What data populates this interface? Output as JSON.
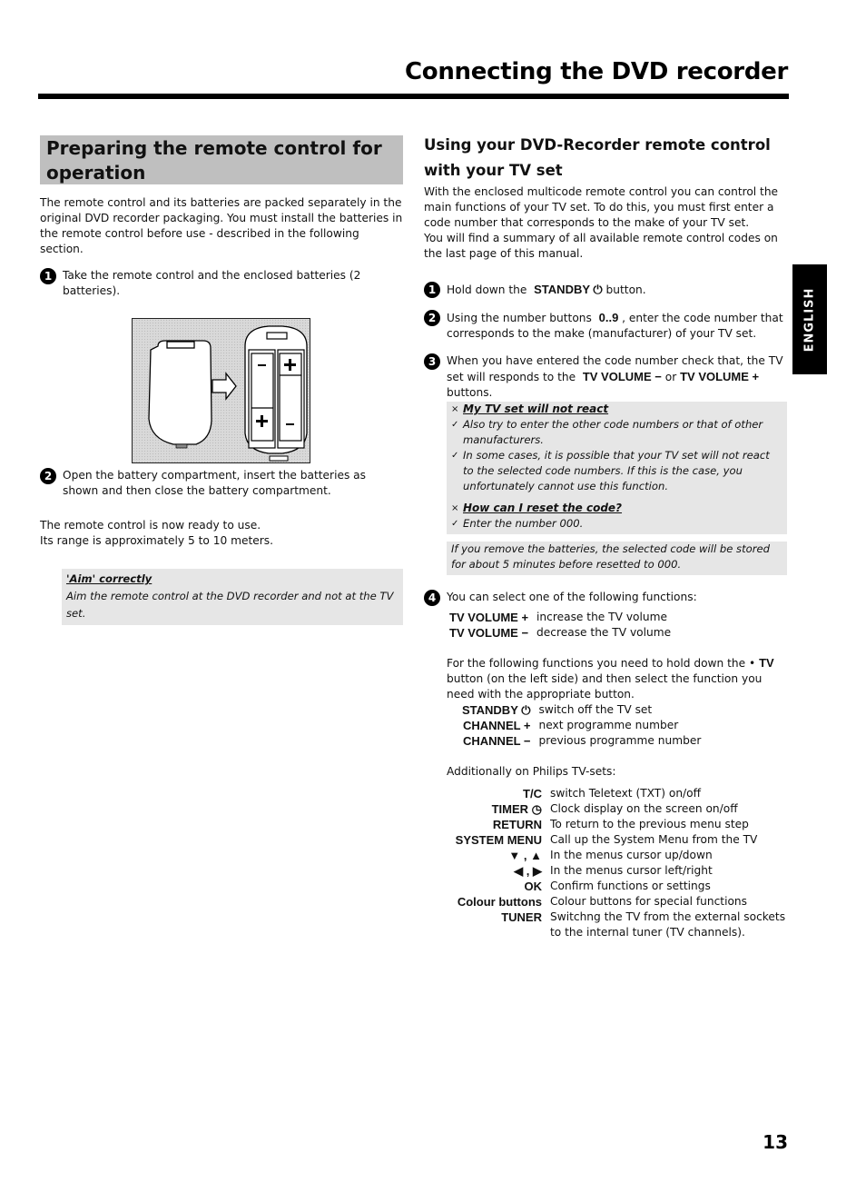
{
  "header": {
    "title": "Connecting the DVD recorder"
  },
  "left": {
    "heading": "Preparing the remote control for operation",
    "intro": "The remote control and its batteries are packed separately in the original DVD recorder packaging. You must install the batteries in the remote control before use - described in the following section.",
    "steps": [
      {
        "num": "1",
        "text": "Take the remote control and the enclosed batteries (2 batteries)."
      },
      {
        "num": "2",
        "text": "Open the battery compartment, insert the batteries as shown and then close the battery compartment."
      }
    ],
    "figure_alt": "Battery cover removed, arrow pointing to open battery compartment with two batteries",
    "ready_line1": "The remote control is now ready to use.",
    "ready_line2": "Its range is approximately 5 to 10 meters.",
    "note": {
      "title": "'Aim' correctly",
      "text": "Aim the remote control at the DVD recorder and not at the TV set."
    }
  },
  "right": {
    "heading_line1": "Using your DVD-Recorder remote control",
    "heading_line2": "with your TV set",
    "intro1": "With the enclosed multicode remote control you can control the main functions of your TV set. To do this, you must first enter a code number that corresponds to the make of your TV set.",
    "intro2": "You will find a summary of all available remote control codes on the last page of this manual.",
    "step1": {
      "num": "1",
      "pre": "Hold down the",
      "button": "STANDBY ⏻",
      "post": "button."
    },
    "step2": {
      "num": "2",
      "pre": "Using the number buttons",
      "button": "0..9",
      "post": ", enter the code number that corresponds to the make (manufacturer) of your TV set."
    },
    "step3": {
      "num": "3",
      "pre": "When you have entered the code number check that, the TV set will responds to the",
      "button1": "TV VOLUME −",
      "mid": "or",
      "button2": "TV VOLUME +",
      "post": "buttons."
    },
    "tips": {
      "q1": "My TV set will not react",
      "a1": "Also try to enter the other code numbers or that of other manufacturers.",
      "a2": "In some cases, it is possible that your TV set will not react to the selected code numbers. If this is the case, you unfortunately cannot use this function.",
      "q2": "How can I reset the code?",
      "a3": "Enter the number 000.",
      "cross_mark": "×",
      "check_mark": "✓"
    },
    "info": "If you remove the batteries, the selected code will be stored for about 5 minutes before resetted to 000.",
    "step4": {
      "num": "4",
      "text": "You can select one of the following functions:"
    },
    "volume_functions": [
      {
        "key": "TV VOLUME +",
        "desc": "increase the TV volume"
      },
      {
        "key": "TV VOLUME −",
        "desc": "decrease the TV volume"
      }
    ],
    "hold_pre": "For the following functions you need to hold down the •",
    "hold_tv": "TV",
    "hold_post": "button (on the left side) and then select the function you need with the appropriate button.",
    "tv_functions": [
      {
        "key": "STANDBY ⏻",
        "desc": "switch off the TV set"
      },
      {
        "key": "CHANNEL +",
        "desc": "next programme number"
      },
      {
        "key": "CHANNEL −",
        "desc": "previous programme number"
      }
    ],
    "philips_intro": "Additionally on Philips TV-sets:",
    "philips_functions": [
      {
        "key": "T/C",
        "desc": "switch Teletext (TXT) on/off"
      },
      {
        "key": "TIMER ◷",
        "desc": "Clock display on the screen on/off"
      },
      {
        "key": "RETURN",
        "desc": "To return to the previous menu step"
      },
      {
        "key": "SYSTEM MENU",
        "desc": "Call up the System Menu from the TV"
      },
      {
        "key": "▼ , ▲",
        "desc": "In the menus cursor up/down"
      },
      {
        "key": "◀ , ▶",
        "desc": "In the menus cursor left/right"
      },
      {
        "key": "OK",
        "desc": "Confirm functions or settings"
      },
      {
        "key": "Colour buttons",
        "desc": "Colour buttons for special functions"
      },
      {
        "key": "TUNER",
        "desc": "Switchng the TV from the external sockets to the internal tuner (TV channels)."
      }
    ]
  },
  "side_tab": "ENGLISH",
  "page_number": "13"
}
